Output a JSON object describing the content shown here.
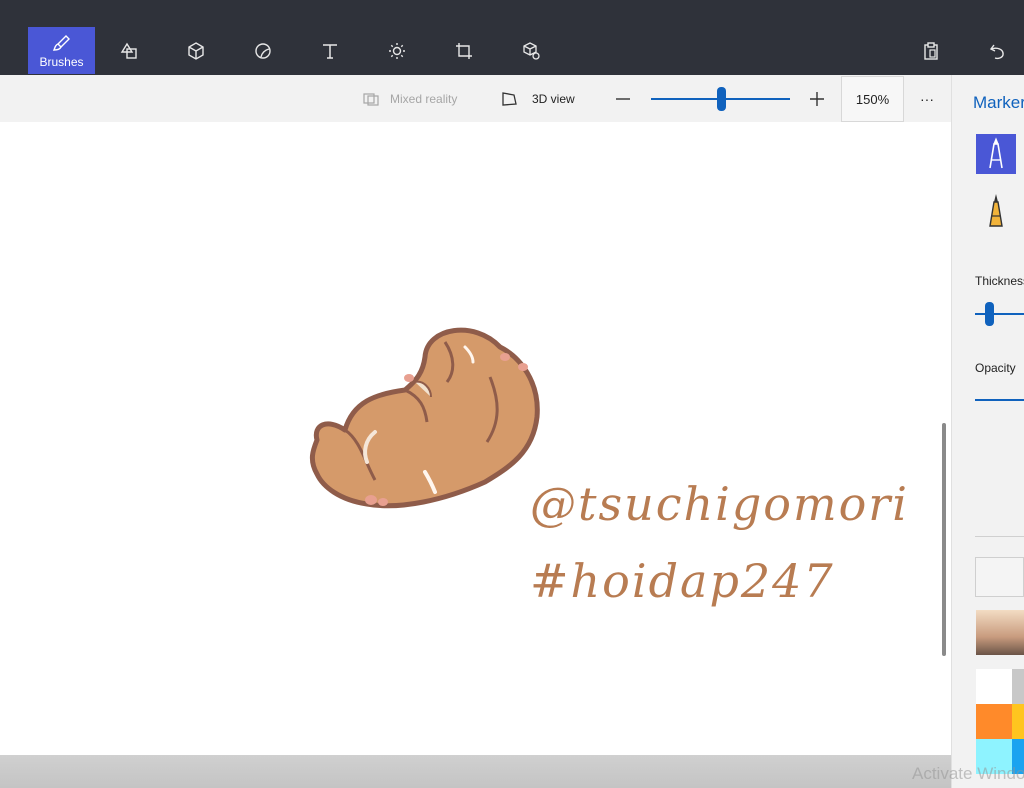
{
  "toolbar": {
    "brushes_label": "Brushes",
    "tools": [
      {
        "icon": "brush-icon"
      },
      {
        "icon": "2d-shapes-icon"
      },
      {
        "icon": "3d-shapes-icon"
      },
      {
        "icon": "stickers-icon"
      },
      {
        "icon": "text-icon"
      },
      {
        "icon": "effects-icon"
      },
      {
        "icon": "canvas-icon"
      },
      {
        "icon": "3d-library-icon"
      }
    ],
    "right_icons": [
      "paste-icon",
      "undo-icon"
    ]
  },
  "subbar": {
    "mixed_reality_label": "Mixed reality",
    "view_3d_label": "3D view",
    "zoom_value": "150%",
    "zoom_slider_fraction": 0.5,
    "more_label": "···"
  },
  "canvas": {
    "text_line_1": "@tsuchigomori",
    "text_line_2": "#hoidap247",
    "text_color": "#b87c52"
  },
  "panel": {
    "title": "Marker",
    "thickness_label": "Thickness",
    "opacity_label": "Opacity",
    "thickness_fraction": 0.2,
    "swatches": [
      "#ffffff",
      "#c8c8c8",
      "#ff8a2a",
      "#ffc51f",
      "#8ef3ff",
      "#1aa3f0"
    ]
  },
  "watermark": "Activate Windows",
  "colors": {
    "accent": "#1062bd",
    "toolbar_bg": "#2f323a",
    "active_tool": "#4a57d6"
  }
}
